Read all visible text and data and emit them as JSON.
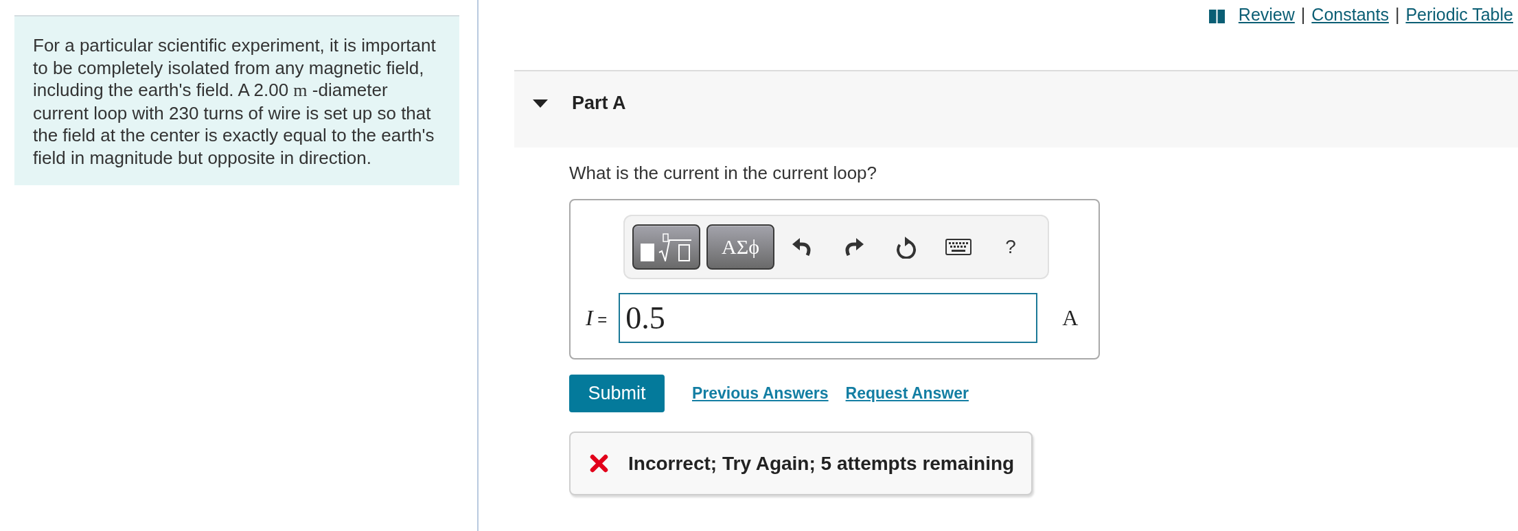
{
  "resource_links": [
    {
      "label": "Review"
    },
    {
      "separator": "|",
      "label": "Constants"
    },
    {
      "separator": "|",
      "label": "Periodic Table"
    }
  ],
  "problem": {
    "segments": [
      {
        "kind": "text",
        "text": "For a particular scientific experiment, it is important to be completely isolated from any magnetic field, including the earth's field. A 2.00 "
      },
      {
        "kind": "math",
        "text": "m"
      },
      {
        "kind": "text",
        "text": " -diameter current loop with 230 turns of wire is set up so that the field at the center is exactly equal to the earth's field in magnitude but opposite in direction."
      }
    ]
  },
  "part": {
    "title": "Part A",
    "expanded": true,
    "question": "What is the current in the current loop?",
    "answer": {
      "toolbar": [
        {
          "kind": "templates"
        },
        {
          "kind": "symbols",
          "label": "ΑΣϕ"
        },
        {
          "kind": "undo"
        },
        {
          "kind": "redo"
        },
        {
          "kind": "reset"
        },
        {
          "kind": "keyboard"
        },
        {
          "kind": "help",
          "label": "?"
        }
      ],
      "variable": "*I* =",
      "value": "0.5",
      "unit": "A"
    },
    "submit": "Submit",
    "links": [
      "Previous Answers",
      "Request Answer"
    ],
    "feedback": {
      "kind": "incorrect",
      "text": "Incorrect; Try Again; 5 attempts remaining"
    }
  }
}
